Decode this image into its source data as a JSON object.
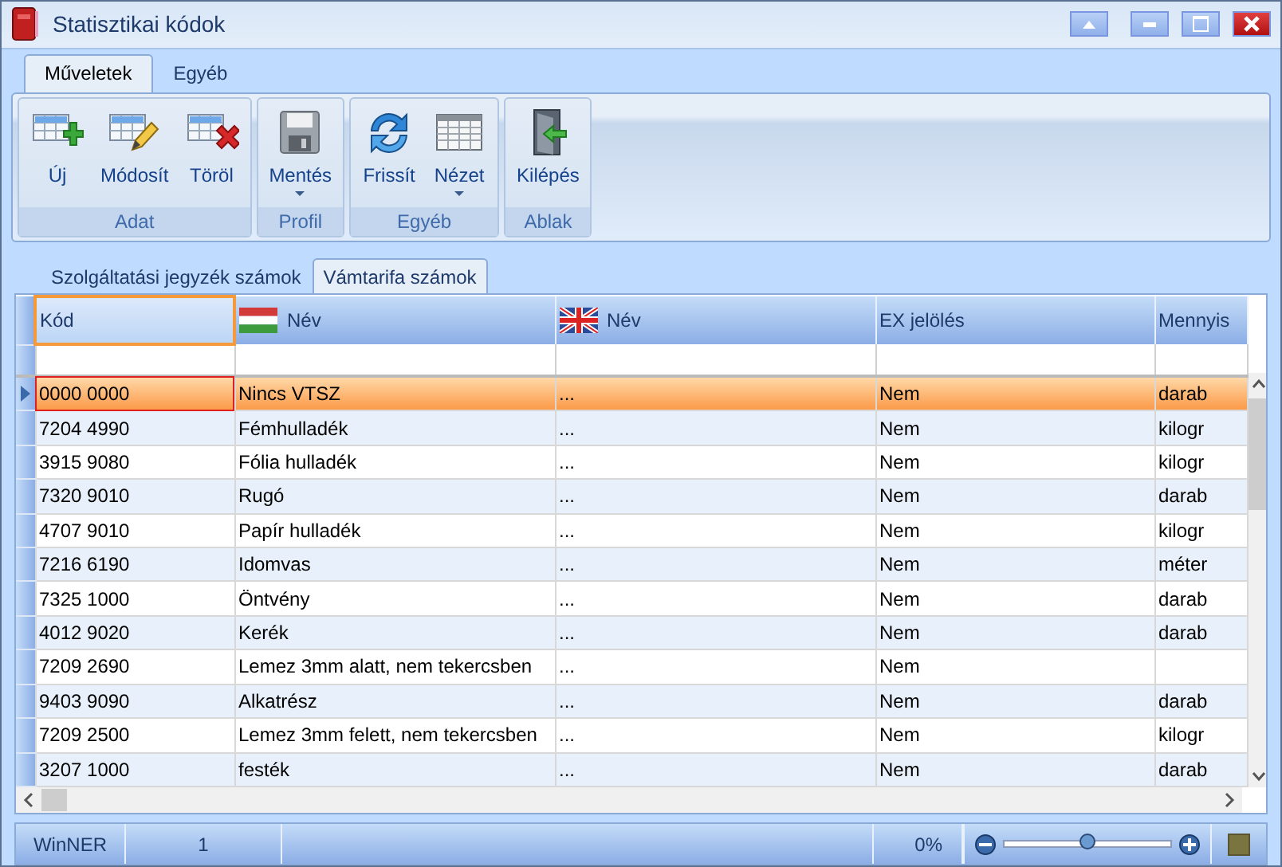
{
  "window": {
    "title": "Statisztikai kódok"
  },
  "ribbon_tabs": [
    {
      "label": "Műveletek",
      "selected": true
    },
    {
      "label": "Egyéb",
      "selected": false
    }
  ],
  "ribbon_groups": [
    {
      "label": "Adat",
      "buttons": [
        {
          "label": "Új",
          "kind": "new"
        },
        {
          "label": "Módosít",
          "kind": "edit"
        },
        {
          "label": "Töröl",
          "kind": "delete"
        }
      ]
    },
    {
      "label": "Profil",
      "buttons": [
        {
          "label": "Mentés",
          "kind": "save",
          "dropdown": true
        }
      ]
    },
    {
      "label": "Egyéb",
      "buttons": [
        {
          "label": "Frissít",
          "kind": "refresh"
        },
        {
          "label": "Nézet",
          "kind": "view",
          "dropdown": true
        }
      ]
    },
    {
      "label": "Ablak",
      "buttons": [
        {
          "label": "Kilépés",
          "kind": "exit"
        }
      ]
    }
  ],
  "grid_tabs": [
    {
      "label": "Szolgáltatási jegyzék számok",
      "selected": false
    },
    {
      "label": "Vámtarifa számok",
      "selected": true
    }
  ],
  "table": {
    "columns": [
      {
        "label": "Kód",
        "kind": "plain",
        "focused": true
      },
      {
        "label": "Név",
        "kind": "hu_flag",
        "focused": false
      },
      {
        "label": "Név",
        "kind": "gb_flag",
        "focused": false
      },
      {
        "label": "EX jelölés",
        "kind": "plain",
        "focused": false
      },
      {
        "label": "Mennyis",
        "kind": "plain",
        "focused": false
      }
    ],
    "rows": [
      {
        "cells": [
          "0000 0000",
          "Nincs VTSZ",
          "...",
          "Nem",
          "darab"
        ],
        "selected": true
      },
      {
        "cells": [
          "7204 4990",
          "Fémhulladék",
          "...",
          "Nem",
          "kilogr"
        ],
        "selected": false
      },
      {
        "cells": [
          "3915 9080",
          "Fólia hulladék",
          "...",
          "Nem",
          "kilogr"
        ],
        "selected": false
      },
      {
        "cells": [
          "7320 9010",
          "Rugó",
          "...",
          "Nem",
          "darab"
        ],
        "selected": false
      },
      {
        "cells": [
          "4707 9010",
          "Papír hulladék",
          "...",
          "Nem",
          "kilogr"
        ],
        "selected": false
      },
      {
        "cells": [
          "7216 6190",
          "Idomvas",
          "...",
          "Nem",
          "méter"
        ],
        "selected": false
      },
      {
        "cells": [
          "7325 1000",
          "Öntvény",
          "...",
          "Nem",
          "darab"
        ],
        "selected": false
      },
      {
        "cells": [
          "4012 9020",
          "Kerék",
          "...",
          "Nem",
          "darab"
        ],
        "selected": false
      },
      {
        "cells": [
          "7209 2690",
          "Lemez 3mm alatt, nem tekercsben",
          "...",
          "Nem",
          ""
        ],
        "selected": false
      },
      {
        "cells": [
          "9403 9090",
          "Alkatrész",
          "...",
          "Nem",
          "darab"
        ],
        "selected": false
      },
      {
        "cells": [
          "7209 2500",
          "Lemez 3mm felett, nem tekercsben",
          "...",
          "Nem",
          "kilogr"
        ],
        "selected": false
      },
      {
        "cells": [
          "3207 1000",
          "festék",
          "...",
          "Nem",
          "darab"
        ],
        "selected": false
      }
    ]
  },
  "status_bar": {
    "app": "WinNER",
    "count": "1",
    "zoom": "0%",
    "level": 0.5
  }
}
